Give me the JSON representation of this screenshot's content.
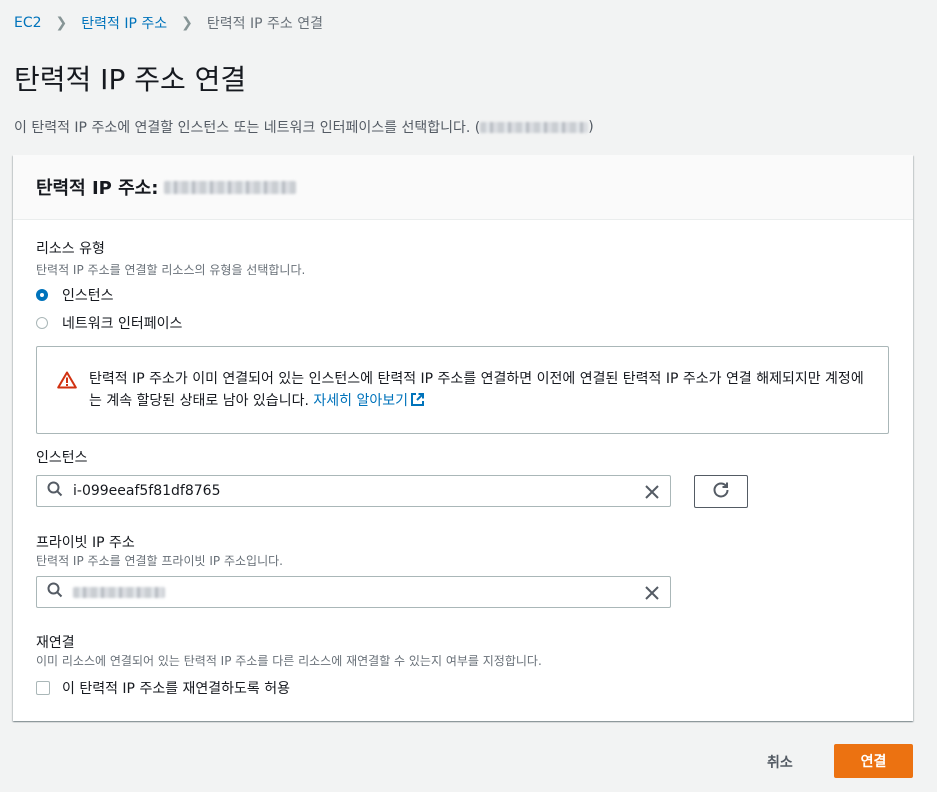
{
  "breadcrumb": {
    "items": [
      "EC2",
      "탄력적 IP 주소",
      "탄력적 IP 주소 연결"
    ]
  },
  "page": {
    "title": "탄력적 IP 주소 연결",
    "description_prefix": "이 탄력적 IP 주소에 연결할 인스턴스 또는 네트워크 인터페이스를 선택합니다. (",
    "description_suffix": ")"
  },
  "panel": {
    "header_label": "탄력적 IP 주소: "
  },
  "resource_type": {
    "label": "리소스 유형",
    "description": "탄력적 IP 주소를 연결할 리소스의 유형을 선택합니다.",
    "options": [
      {
        "label": "인스턴스",
        "selected": true
      },
      {
        "label": "네트워크 인터페이스",
        "selected": false
      }
    ]
  },
  "alert": {
    "text": "탄력적 IP 주소가 이미 연결되어 있는 인스턴스에 탄력적 IP 주소를 연결하면 이전에 연결된 탄력적 IP 주소가 연결 해제되지만 계정에는 계속 할당된 상태로 남아 있습니다. ",
    "link_label": "자세히 알아보기"
  },
  "instance": {
    "label": "인스턴스",
    "value": "i-099eeaf5f81df8765"
  },
  "private_ip": {
    "label": "프라이빗 IP 주소",
    "description": "탄력적 IP 주소를 연결할 프라이빗 IP 주소입니다."
  },
  "reassociation": {
    "label": "재연결",
    "description": "이미 리소스에 연결되어 있는 탄력적 IP 주소를 다른 리소스에 재연결할 수 있는지 여부를 지정합니다.",
    "checkbox_label": "이 탄력적 IP 주소를 재연결하도록 허용",
    "checked": false
  },
  "footer": {
    "cancel_label": "취소",
    "submit_label": "연결"
  },
  "icons": {
    "search": "search-icon",
    "clear": "close-icon",
    "refresh": "refresh-icon",
    "warning": "warning-icon",
    "external": "external-link-icon"
  },
  "colors": {
    "link": "#0073bb",
    "primary_button": "#ec7211",
    "warning": "#d13212",
    "radio_selected": "#0073bb"
  }
}
